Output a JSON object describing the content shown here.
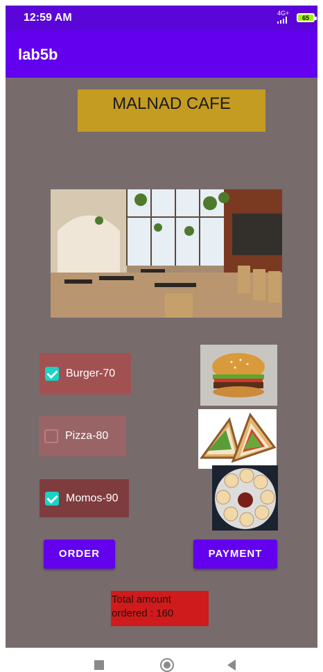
{
  "status_bar": {
    "time": "12:59 AM",
    "network": "4G+",
    "battery": "65"
  },
  "app_bar": {
    "title": "lab5b"
  },
  "cafe": {
    "title": "MALNAD CAFE"
  },
  "menu": [
    {
      "label": "Burger-70",
      "checked": true
    },
    {
      "label": "Pizza-80",
      "checked": false
    },
    {
      "label": "Momos-90",
      "checked": true
    }
  ],
  "buttons": {
    "order": "ORDER",
    "payment": "PAYMENT"
  },
  "total": {
    "text": "Total amount ordered : 160"
  },
  "colors": {
    "status_bar": "#5b06d8",
    "app_bar": "#6300ee",
    "background": "#776b6c",
    "title_box": "#c49c22",
    "checkbox_checked": "#19d3c5",
    "total_box": "#cf1b1b"
  },
  "icons": [
    "check-icon",
    "stop-icon",
    "home-icon",
    "back-icon",
    "signal-icon",
    "battery-icon"
  ]
}
